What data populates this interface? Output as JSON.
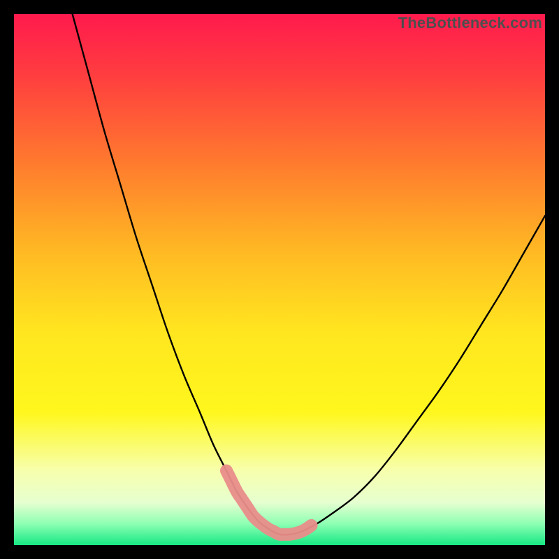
{
  "watermark": {
    "text": "TheBottleneck.com"
  },
  "gradient": {
    "stops": [
      {
        "pct": 0,
        "color": "#ff1a4d"
      },
      {
        "pct": 12,
        "color": "#ff3f3f"
      },
      {
        "pct": 28,
        "color": "#ff7a2e"
      },
      {
        "pct": 45,
        "color": "#ffba23"
      },
      {
        "pct": 60,
        "color": "#ffe61f"
      },
      {
        "pct": 75,
        "color": "#fff71e"
      },
      {
        "pct": 86,
        "color": "#f7ffad"
      },
      {
        "pct": 92,
        "color": "#e6ffd0"
      },
      {
        "pct": 96,
        "color": "#8dffb3"
      },
      {
        "pct": 100,
        "color": "#17e884"
      }
    ]
  },
  "chart_data": {
    "type": "line",
    "title": "",
    "xlabel": "",
    "ylabel": "",
    "xlim": [
      0,
      100
    ],
    "ylim": [
      0,
      100
    ],
    "annotations": [
      "TheBottleneck.com"
    ],
    "series": [
      {
        "name": "bottleneck-curve",
        "color": "#000000",
        "x": [
          11,
          14,
          17,
          20,
          23,
          26,
          29,
          32,
          35,
          37.5,
          40,
          42,
          44,
          46,
          48,
          50,
          52,
          54,
          57,
          60,
          64,
          68,
          72,
          76,
          80,
          84,
          88,
          92,
          96,
          100
        ],
        "y": [
          100,
          89,
          78,
          68,
          58,
          49,
          40,
          32,
          25,
          19,
          14,
          10,
          7,
          4.5,
          3,
          2,
          2,
          2.5,
          4,
          6,
          9,
          13,
          18,
          23.5,
          29,
          35,
          41.5,
          48,
          55,
          62
        ]
      },
      {
        "name": "highlight-band",
        "color": "#e98d8a",
        "style": "thick",
        "x": [
          40,
          41,
          42,
          43,
          44,
          45,
          46,
          47,
          48,
          49,
          50,
          51,
          52,
          53,
          54,
          55,
          56
        ],
        "y": [
          14,
          12,
          10,
          8.5,
          7,
          5.5,
          4.5,
          3.7,
          3,
          2.5,
          2,
          2,
          2,
          2.2,
          2.5,
          3,
          3.7
        ]
      }
    ]
  }
}
